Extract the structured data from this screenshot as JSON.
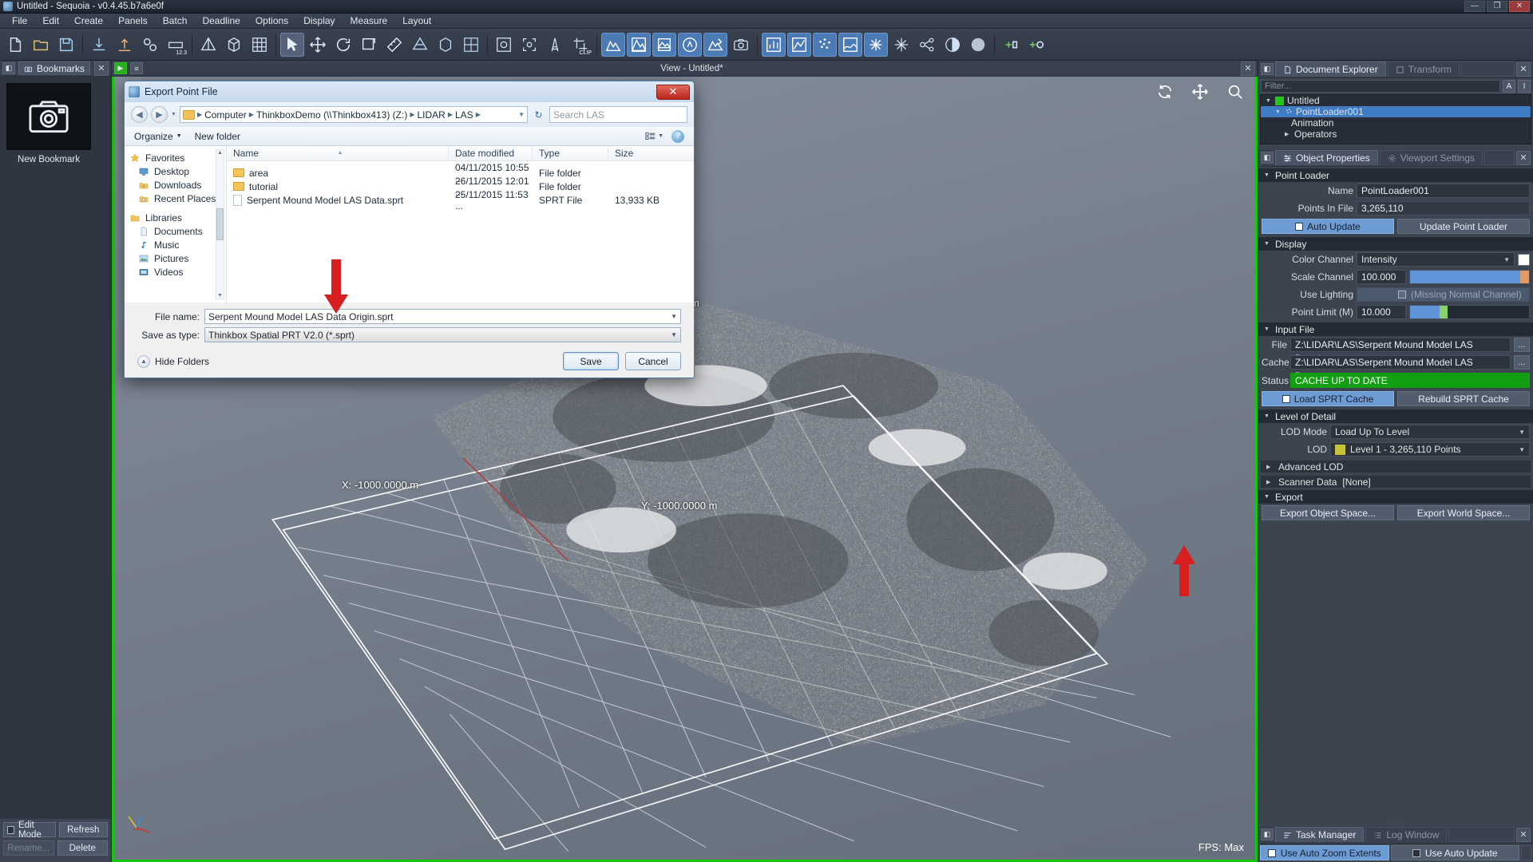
{
  "window": {
    "title": "Untitled - Sequoia - v0.4.45.b7a6e0f",
    "minimize": "—",
    "maximize": "❐",
    "close": "✕"
  },
  "menu": [
    "File",
    "Edit",
    "Create",
    "Panels",
    "Batch",
    "Deadline",
    "Options",
    "Display",
    "Measure",
    "Layout"
  ],
  "toolbar": {
    "clip_label": "CLIP",
    "num_label": "12.3"
  },
  "bookmarks": {
    "tab": "Bookmarks",
    "new_bookmark": "New Bookmark",
    "edit_mode": "Edit Mode",
    "refresh": "Refresh",
    "rename": "Rename...",
    "delete": "Delete"
  },
  "viewport": {
    "title": "View - Untitled*",
    "x_label": "X:  -1000.0000  m",
    "y_label": "Y:  -1000.0000  m",
    "m_label": "m",
    "fps": "FPS:  Max",
    "icons": [
      "refresh-icon",
      "move-icon",
      "search-icon"
    ]
  },
  "right": {
    "tabs_top": [
      {
        "label": "Document Explorer",
        "icon": "document-icon",
        "active": true
      },
      {
        "label": "Transform",
        "icon": "transform-icon",
        "active": false
      }
    ],
    "filter_placeholder": "Filter...",
    "filter_buttons": [
      "A",
      "I"
    ],
    "outliner": [
      {
        "label": "Untitled",
        "depth": 0,
        "selected": false,
        "swatch": "#22c71a"
      },
      {
        "label": "PointLoader001",
        "depth": 1,
        "selected": true
      },
      {
        "label": "Animation",
        "depth": 2,
        "selected": false
      },
      {
        "label": "Operators",
        "depth": 2,
        "selected": false
      }
    ],
    "tabs_props": [
      {
        "label": "Object Properties",
        "active": true
      },
      {
        "label": "Viewport Settings",
        "active": false
      }
    ],
    "point_loader": {
      "section": "Point Loader",
      "name_label": "Name",
      "name_value": "PointLoader001",
      "points_label": "Points In File",
      "points_value": "3,265,110",
      "auto_update": "Auto Update",
      "update_button": "Update Point Loader"
    },
    "display": {
      "section": "Display",
      "color_channel_label": "Color Channel",
      "color_channel_value": "Intensity",
      "scale_channel_label": "Scale Channel",
      "scale_channel_value": "100.000",
      "use_lighting_label": "Use Lighting",
      "use_lighting_note": "(Missing Normal Channel)",
      "point_limit_label": "Point Limit (M)",
      "point_limit_value": "10.000"
    },
    "input_file": {
      "section": "Input File",
      "file_label": "File",
      "file_value": "Z:\\LIDAR\\LAS\\Serpent Mound Model LAS Data.laz",
      "cache_label": "Cache",
      "cache_value": "Z:\\LIDAR\\LAS\\Serpent Mound Model LAS Data.sprt",
      "status_label": "Status",
      "status_value": "CACHE UP TO DATE",
      "status_color": "#12a012",
      "load_cache": "Load SPRT Cache",
      "rebuild_cache": "Rebuild SPRT Cache",
      "browse": "..."
    },
    "lod": {
      "section": "Level of Detail",
      "mode_label": "LOD Mode",
      "mode_value": "Load Up To Level",
      "lod_label": "LOD",
      "lod_value": "Level 1 - 3,265,110 Points",
      "advanced": "Advanced LOD",
      "scanner": "Scanner Data",
      "scanner_value": "[None]"
    },
    "export": {
      "section": "Export",
      "object_space": "Export Object Space...",
      "world_space": "Export World Space..."
    },
    "bottom_tabs": [
      {
        "label": "Task Manager",
        "active": true
      },
      {
        "label": "Log Window",
        "active": false
      }
    ],
    "bottom_buttons": [
      {
        "label": "Use Auto Zoom Extents",
        "checked": true
      },
      {
        "label": "Use Auto Update",
        "checked": false
      }
    ]
  },
  "dialog": {
    "title": "Export Point File",
    "close": "✕",
    "breadcrumb": [
      "Computer",
      "ThinkboxDemo (\\\\Thinkbox413) (Z:)",
      "LIDAR",
      "LAS"
    ],
    "search_placeholder": "Search LAS",
    "organize": "Organize",
    "new_folder": "New folder",
    "columns": [
      "Name",
      "Date modified",
      "Type",
      "Size"
    ],
    "nav_pane": [
      {
        "label": "Favorites",
        "icon": "star-icon",
        "level": 0
      },
      {
        "label": "Desktop",
        "icon": "desktop-icon",
        "level": 1
      },
      {
        "label": "Downloads",
        "icon": "downloads-icon",
        "level": 1
      },
      {
        "label": "Recent Places",
        "icon": "recent-icon",
        "level": 1
      },
      {
        "label": "Libraries",
        "icon": "libraries-icon",
        "level": 0
      },
      {
        "label": "Documents",
        "icon": "documents-icon",
        "level": 1
      },
      {
        "label": "Music",
        "icon": "music-icon",
        "level": 1
      },
      {
        "label": "Pictures",
        "icon": "pictures-icon",
        "level": 1
      },
      {
        "label": "Videos",
        "icon": "videos-icon",
        "level": 1
      }
    ],
    "files": [
      {
        "name": "area",
        "date": "04/11/2015 10:55 ...",
        "type": "File folder",
        "size": "",
        "kind": "folder"
      },
      {
        "name": "tutorial",
        "date": "26/11/2015 12:01 ...",
        "type": "File folder",
        "size": "",
        "kind": "folder"
      },
      {
        "name": "Serpent Mound Model LAS Data.sprt",
        "date": "25/11/2015 11:53 ...",
        "type": "SPRT File",
        "size": "13,933 KB",
        "kind": "file"
      }
    ],
    "file_name_label": "File name:",
    "file_name_value": "Serpent Mound Model LAS Data Origin.sprt",
    "save_type_label": "Save as type:",
    "save_type_value": "Thinkbox Spatial PRT V2.0 (*.sprt)",
    "hide_folders": "Hide Folders",
    "save": "Save",
    "cancel": "Cancel"
  }
}
